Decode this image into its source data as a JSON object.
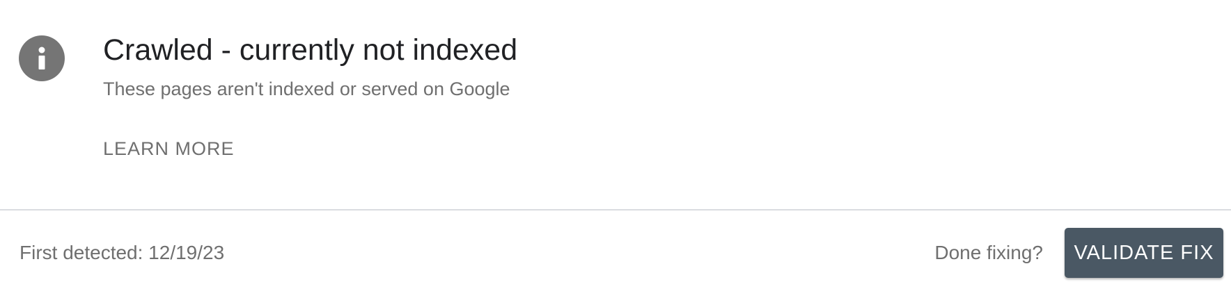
{
  "issue": {
    "icon": "info-icon",
    "title": "Crawled - currently not indexed",
    "subtitle": "These pages aren't indexed or served on Google",
    "learn_more_label": "LEARN MORE"
  },
  "footer": {
    "first_detected": "First detected: 12/19/23",
    "done_fixing_prompt": "Done fixing?",
    "validate_fix_label": "VALIDATE FIX"
  },
  "colors": {
    "icon_bg": "#757575",
    "title_text": "#202124",
    "secondary_text": "#6f6f6f",
    "button_bg": "#4a5864",
    "button_text": "#ffffff",
    "divider": "#dadce0"
  }
}
